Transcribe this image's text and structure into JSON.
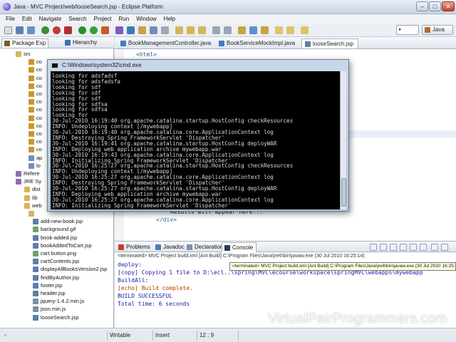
{
  "window": {
    "title": "Java - MVC Project/web/looseSearch.jsp - Eclipse Platform",
    "minimize": "–",
    "maximize": "□",
    "close": "✕"
  },
  "menu": [
    "File",
    "Edit",
    "Navigate",
    "Search",
    "Project",
    "Run",
    "Window",
    "Help"
  ],
  "perspective": {
    "label": "Java"
  },
  "left_tabs": [
    "Package Exp",
    "Hierarchy"
  ],
  "tree": [
    {
      "label": "src",
      "icon": "folder-icon"
    },
    {
      "label": "co",
      "icon": "package-icon"
    },
    {
      "label": "co",
      "icon": "package-icon"
    },
    {
      "label": "co",
      "icon": "package-icon"
    },
    {
      "label": "co",
      "icon": "package-icon"
    },
    {
      "label": "co",
      "icon": "package-icon"
    },
    {
      "label": "co",
      "icon": "package-icon"
    },
    {
      "label": "co",
      "icon": "package-icon"
    },
    {
      "label": "co",
      "icon": "package-icon"
    },
    {
      "label": "co",
      "icon": "package-icon"
    },
    {
      "label": "co",
      "icon": "package-icon"
    },
    {
      "label": "co",
      "icon": "package-icon"
    },
    {
      "label": "co",
      "icon": "package-icon"
    },
    {
      "label": "ap",
      "icon": "file-icon"
    },
    {
      "label": "lo",
      "icon": "file-icon"
    },
    {
      "label": "Refere",
      "icon": "library-icon"
    },
    {
      "label": "JRE Sy",
      "icon": "library-icon"
    },
    {
      "label": "dist",
      "icon": "folder-icon"
    },
    {
      "label": "lib",
      "icon": "folder-icon"
    },
    {
      "label": "web",
      "icon": "folder-icon"
    },
    {
      "label": "",
      "icon": "folder-icon"
    },
    {
      "label": "add-new-book.jsp",
      "icon": "jsp-icon"
    },
    {
      "label": "background.gif",
      "icon": "image-icon"
    },
    {
      "label": "book-added.jsp",
      "icon": "jsp-icon"
    },
    {
      "label": "bookAddedToCart.jsp",
      "icon": "jsp-icon"
    },
    {
      "label": "cart button.png",
      "icon": "image-icon"
    },
    {
      "label": "cartContents.jsp",
      "icon": "jsp-icon"
    },
    {
      "label": "displayAllBooksVersion2.jsp",
      "icon": "jsp-icon"
    },
    {
      "label": "findByAuthor.jsp",
      "icon": "jsp-icon"
    },
    {
      "label": "footer.jsp",
      "icon": "jsp-icon"
    },
    {
      "label": "header.jsp",
      "icon": "jsp-icon"
    },
    {
      "label": "jquery-1.4.2.min.js",
      "icon": "js-icon"
    },
    {
      "label": "json.min.js",
      "icon": "js-icon"
    },
    {
      "label": "looseSearch.jsp",
      "icon": "jsp-icon"
    }
  ],
  "editor_tabs": [
    "BookManagementController.java",
    "BookServiceMockImpl.java",
    "looseSearch.jsp"
  ],
  "editor_lines": [
    "<html>",
    "Results will appear here...",
    "</div>"
  ],
  "view_tabs": [
    "Problems",
    "Javadoc",
    "Declaration",
    "Console"
  ],
  "console": {
    "header": "<terminated> MVC Project build.xml [Ant Build] C:\\Program Files\\Java\\jre6\\bin\\javaw.exe (30 Jul 2010 16:25:14)",
    "tooltip": "<terminated> MVC Project build.xml [Ant Build] C:\\Program Files\\Java\\jre6\\bin\\javaw.exe (30 Jul 2010 16:25:14)",
    "lines": [
      {
        "text": "deploy:",
        "color": "#1a1aa8"
      },
      {
        "text": "     [copy] Copying 1 file to D:\\ecl..\\spring\\MVC\\ecourse\\workspace\\springMVC\\webapps\\mywebapp",
        "color": "#1a1aa8"
      },
      {
        "text": "BuildAll:",
        "color": "#1a1aa8"
      },
      {
        "text": "     [echo] Build complete.",
        "color": "#b83a00"
      },
      {
        "text": "BUILD SUCCESSFUL",
        "color": "#1a1aa8"
      },
      {
        "text": "Total time: 6 seconds",
        "color": "#1a1aa8"
      }
    ]
  },
  "status": {
    "mode": "Writable",
    "insert": "Insert",
    "position": "12 : 9"
  },
  "watermark": "VirtualPairProgrammers.com",
  "cmd": {
    "title": "C:\\Windows\\system32\\cmd.exe",
    "lines": [
      "looking for adsfadsf",
      "looking for adsfadsfa",
      "looking for sdf",
      "looking for sdf",
      "looking for sdf",
      "looking for sdfsa",
      "looking for sdfsa",
      "looking for",
      "30-Jul-2010 16:19:40 org.apache.catalina.startup.HostConfig checkResources",
      "INFO: Undeploying context [/mywebapp]",
      "30-Jul-2010 16:19:40 org.apache.catalina.core.ApplicationContext log",
      "INFO: Destroying Spring FrameworkServlet 'Dispatcher'",
      "30-Jul-2010 16:19:41 org.apache.catalina.startup.HostConfig deployWAR",
      "INFO: Deploying web application archive mywebapp.war",
      "30-Jul-2010 16:19:43 org.apache.catalina.core.ApplicationContext log",
      "INFO: Initializing Spring FrameworkServlet 'Dispatcher'",
      "30-Jul-2010 16:25:27 org.apache.catalina.startup.HostConfig checkResources",
      "INFO: Undeploying context [/mywebapp]",
      "30-Jul-2010 16:25:27 org.apache.catalina.core.ApplicationContext log",
      "INFO: Destroying Spring FrameworkServlet 'Dispatcher'",
      "30-Jul-2010 16:25:27 org.apache.catalina.startup.HostConfig deployWAR",
      "INFO: Deploying web application archive mywebapp.war",
      "30-Jul-2010 16:25:27 org.apache.catalina.core.ApplicationContext log",
      "INFO: Initializing Spring FrameworkServlet 'Dispatcher'"
    ]
  }
}
